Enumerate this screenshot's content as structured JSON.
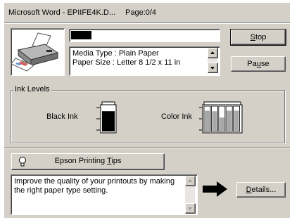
{
  "window": {
    "title": "Microsoft Word - EPIIFE4K.D...",
    "page_status": "Page:0/4"
  },
  "progress": {
    "fraction": 0.14
  },
  "media_info": {
    "line1": "Media Type : Plain Paper",
    "line2": "Paper Size : Letter 8 1/2 x 11 in"
  },
  "buttons": {
    "stop_pre": "",
    "stop_key": "S",
    "stop_post": "top",
    "pause_pre": "Pa",
    "pause_key": "u",
    "pause_post": "se",
    "tips_pre": "Epson Printing ",
    "tips_key": "T",
    "tips_post": "ips",
    "details_pre": "",
    "details_key": "D",
    "details_post": "etails..."
  },
  "ink_levels": {
    "title": "Ink Levels",
    "black_label": "Black Ink",
    "color_label": "Color Ink",
    "black_level": 0.8,
    "color_levels": [
      0.82,
      0.8,
      0.55,
      0.82,
      0.82
    ]
  },
  "tip": {
    "text": "Improve the quality of your printouts by making the right paper type setting."
  },
  "icons": [
    "printer-icon",
    "lightbulb-icon",
    "arrow-right-icon"
  ]
}
